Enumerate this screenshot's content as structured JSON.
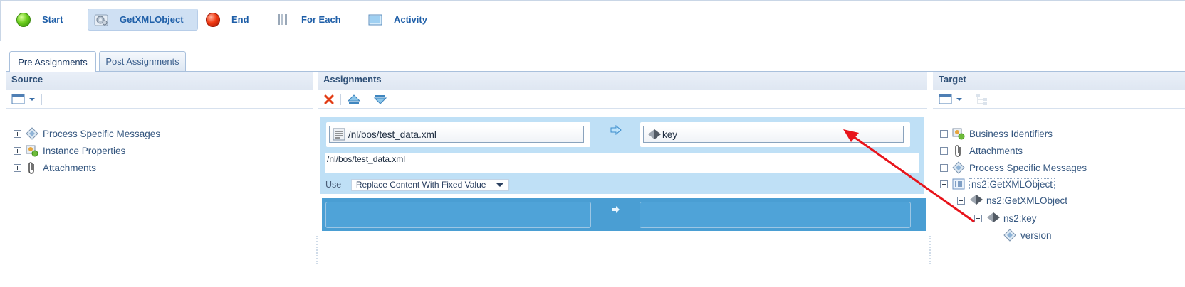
{
  "toolbar": {
    "items": [
      {
        "label": "Start",
        "icon": "green-ball-icon"
      },
      {
        "label": "GetXMLObject",
        "icon": "gear-icon"
      },
      {
        "label": "End",
        "icon": "red-ball-icon"
      },
      {
        "label": "For Each",
        "icon": "for-each-icon"
      },
      {
        "label": "Activity",
        "icon": "activity-icon"
      }
    ]
  },
  "tabs": [
    {
      "label": "Pre Assignments",
      "selected": true
    },
    {
      "label": "Post Assignments",
      "selected": false
    }
  ],
  "source": {
    "title": "Source",
    "tree": [
      {
        "label": "Process Specific Messages",
        "icon": "message-diamond-icon"
      },
      {
        "label": "Instance Properties",
        "icon": "instance-properties-icon"
      },
      {
        "label": "Attachments",
        "icon": "paperclip-icon"
      }
    ]
  },
  "assignments": {
    "title": "Assignments",
    "row1": {
      "source_value": "/nl/bos/test_data.xml",
      "target_value": "key",
      "path": "/nl/bos/test_data.xml",
      "use_label": "Use -",
      "use_option": "Replace Content With Fixed Value"
    }
  },
  "target": {
    "title": "Target",
    "tree": [
      {
        "label": "Business Identifiers"
      },
      {
        "label": "Attachments"
      },
      {
        "label": "Process Specific Messages"
      },
      {
        "label": "ns2:GetXMLObject"
      },
      {
        "label": "ns2:GetXMLObject"
      },
      {
        "label": "ns2:key"
      },
      {
        "label": "version"
      }
    ]
  },
  "colors": {
    "accent": "#1f5fa8",
    "assignment_bg": "#bfe0f6",
    "assignment_dark": "#4a9ed3",
    "annotation_arrow": "#e8141b"
  }
}
